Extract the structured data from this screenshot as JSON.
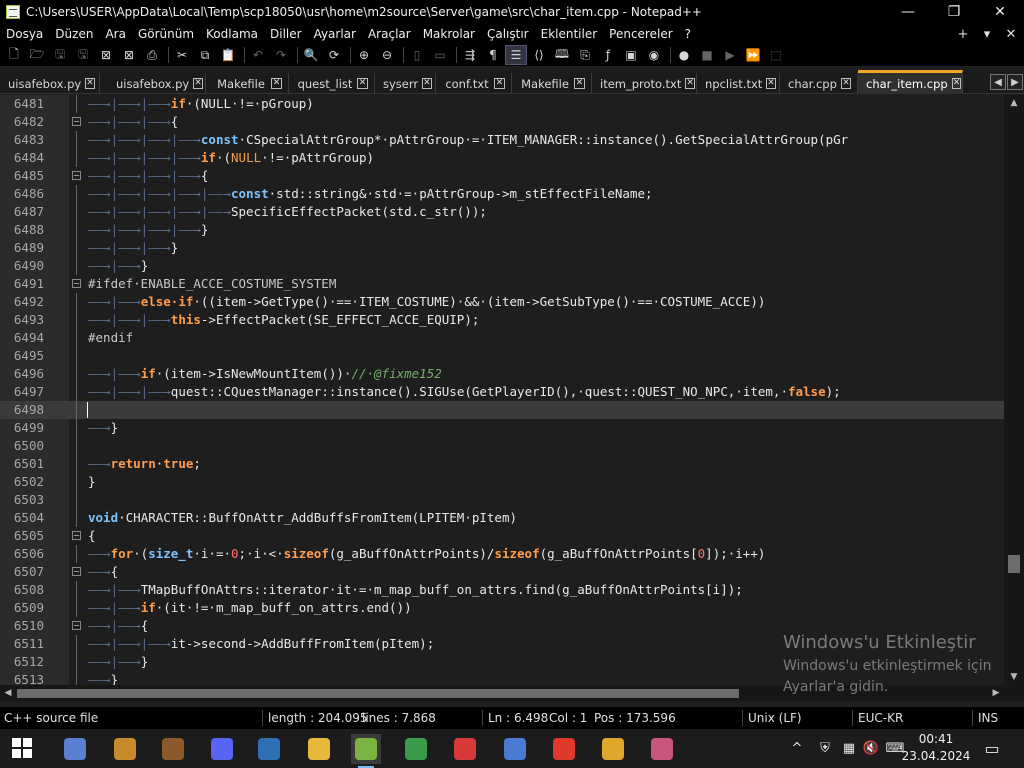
{
  "window": {
    "title": "C:\\Users\\USER\\AppData\\Local\\Temp\\scp18050\\usr\\home\\m2source\\Server\\game\\src\\char_item.cpp - Notepad++",
    "minimize": "—",
    "maximize": "❐",
    "close": "✕"
  },
  "menu": {
    "items": [
      "Dosya",
      "Düzen",
      "Ara",
      "Görünüm",
      "Kodlama",
      "Diller",
      "Ayarlar",
      "Araçlar",
      "Makrolar",
      "Çalıştır",
      "Eklentiler",
      "Pencereler",
      "?"
    ],
    "add": "+",
    "dropdown": "▾",
    "close": "✕"
  },
  "toolbar": {
    "icons": [
      "new-file-icon",
      "open-file-icon",
      "save-icon",
      "save-all-icon",
      "close-icon",
      "close-all-icon",
      "print-icon",
      "cut-icon",
      "copy-icon",
      "paste-icon",
      "undo-icon",
      "redo-icon",
      "find-icon",
      "replace-icon",
      "zoom-in-icon",
      "zoom-out-icon",
      "sync-vertical-icon",
      "sync-horizontal-icon",
      "word-wrap-icon",
      "show-all-chars-icon",
      "indent-guide-icon",
      "xml-icon",
      "book-icon",
      "clipboard-icon",
      "function-list-icon",
      "monitor-icon",
      "panel-icon",
      "record-macro-icon",
      "stop-record-icon",
      "play-macro-icon",
      "play-multiple-icon",
      "save-macro-icon"
    ]
  },
  "tabs": [
    {
      "label": "uisafebox.py"
    },
    {
      "label": "uisafebox.py"
    },
    {
      "label": "Makefile"
    },
    {
      "label": "quest_list"
    },
    {
      "label": "syserr"
    },
    {
      "label": "conf.txt"
    },
    {
      "label": "Makefile"
    },
    {
      "label": "item_proto.txt"
    },
    {
      "label": "npclist.txt"
    },
    {
      "label": "char.cpp"
    },
    {
      "label": "char_item.cpp"
    }
  ],
  "tab_close_glyph": "✕",
  "tab_nav": {
    "prev": "◀",
    "next": "▶"
  },
  "editor": {
    "lines": [
      {
        "n": "6481",
        "tokens": [
          [
            "ws",
            "——→|——→|——→"
          ],
          [
            "kw",
            "if"
          ],
          [
            "op",
            "·(NULL·!=·"
          ],
          [
            "id",
            "pGroup"
          ],
          [
            "op",
            ")"
          ]
        ]
      },
      {
        "n": "6482",
        "tokens": [
          [
            "ws",
            "——→|——→|——→"
          ],
          [
            "op",
            "{"
          ]
        ]
      },
      {
        "n": "6483",
        "tokens": [
          [
            "ws",
            "——→|——→|——→|——→"
          ],
          [
            "type",
            "const"
          ],
          [
            "op",
            "·"
          ],
          [
            "id",
            "CSpecialAttrGroup"
          ],
          [
            "op",
            "*·"
          ],
          [
            "id",
            "pAttrGroup"
          ],
          [
            "op",
            "·=·"
          ],
          [
            "id",
            "ITEM_MANAGER"
          ],
          [
            "op",
            "::"
          ],
          [
            "id",
            "instance"
          ],
          [
            "op",
            "()."
          ],
          [
            "id",
            "GetSpecialAttrGroup"
          ],
          [
            "op",
            "(pGr"
          ]
        ]
      },
      {
        "n": "6484",
        "tokens": [
          [
            "ws",
            "——→|——→|——→|——→"
          ],
          [
            "kw",
            "if"
          ],
          [
            "op",
            "·("
          ],
          [
            "const",
            "NULL"
          ],
          [
            "op",
            "·!=·"
          ],
          [
            "id",
            "pAttrGroup"
          ],
          [
            "op",
            ")"
          ]
        ]
      },
      {
        "n": "6485",
        "tokens": [
          [
            "ws",
            "——→|——→|——→|——→"
          ],
          [
            "op",
            "{"
          ]
        ]
      },
      {
        "n": "6486",
        "tokens": [
          [
            "ws",
            "——→|——→|——→|——→|——→"
          ],
          [
            "type",
            "const"
          ],
          [
            "op",
            "·"
          ],
          [
            "id",
            "std"
          ],
          [
            "op",
            "::"
          ],
          [
            "id",
            "string"
          ],
          [
            "op",
            "&·"
          ],
          [
            "id",
            "std"
          ],
          [
            "op",
            "·=·"
          ],
          [
            "id",
            "pAttrGroup"
          ],
          [
            "op",
            "->"
          ],
          [
            "id",
            "m_stEffectFileName"
          ],
          [
            "op",
            ";"
          ]
        ]
      },
      {
        "n": "6487",
        "tokens": [
          [
            "ws",
            "——→|——→|——→|——→|——→"
          ],
          [
            "id",
            "SpecificEffectPacket"
          ],
          [
            "op",
            "(std.c_str());"
          ]
        ]
      },
      {
        "n": "6488",
        "tokens": [
          [
            "ws",
            "——→|——→|——→|——→"
          ],
          [
            "op",
            "}"
          ]
        ]
      },
      {
        "n": "6489",
        "tokens": [
          [
            "ws",
            "——→|——→|——→"
          ],
          [
            "op",
            "}"
          ]
        ]
      },
      {
        "n": "6490",
        "tokens": [
          [
            "ws",
            "——→|——→"
          ],
          [
            "op",
            "}"
          ]
        ]
      },
      {
        "n": "6491",
        "tokens": [
          [
            "pp",
            "#ifdef·ENABLE_ACCE_COSTUME_SYSTEM"
          ]
        ]
      },
      {
        "n": "6492",
        "tokens": [
          [
            "ws",
            "——→|——→"
          ],
          [
            "kw",
            "else·if"
          ],
          [
            "op",
            "·((item->"
          ],
          [
            "id",
            "GetType"
          ],
          [
            "op",
            "()·==·"
          ],
          [
            "id",
            "ITEM_COSTUME"
          ],
          [
            "op",
            ")·&&·(item->"
          ],
          [
            "id",
            "GetSubType"
          ],
          [
            "op",
            "()·==·"
          ],
          [
            "id",
            "COSTUME_ACCE"
          ],
          [
            "op",
            "))"
          ]
        ]
      },
      {
        "n": "6493",
        "tokens": [
          [
            "ws",
            "——→|——→|——→"
          ],
          [
            "kw",
            "this"
          ],
          [
            "op",
            "->"
          ],
          [
            "id",
            "EffectPacket"
          ],
          [
            "op",
            "(SE_EFFECT_ACCE_EQUIP);"
          ]
        ]
      },
      {
        "n": "6494",
        "tokens": [
          [
            "pp",
            "#endif"
          ]
        ]
      },
      {
        "n": "6495",
        "tokens": []
      },
      {
        "n": "6496",
        "tokens": [
          [
            "ws",
            "——→|——→"
          ],
          [
            "kw",
            "if"
          ],
          [
            "op",
            "·(item->"
          ],
          [
            "id",
            "IsNewMountItem"
          ],
          [
            "op",
            "())·"
          ],
          [
            "cm",
            "//·@fixme152"
          ]
        ]
      },
      {
        "n": "6497",
        "tokens": [
          [
            "ws",
            "——→|——→|——→"
          ],
          [
            "id",
            "quest"
          ],
          [
            "op",
            "::"
          ],
          [
            "id",
            "CQuestManager"
          ],
          [
            "op",
            "::"
          ],
          [
            "id",
            "instance"
          ],
          [
            "op",
            "()."
          ],
          [
            "id",
            "SIGUse"
          ],
          [
            "op",
            "("
          ],
          [
            "id",
            "GetPlayerID"
          ],
          [
            "op",
            "(),·quest::QUEST_NO_NPC,·item,·"
          ],
          [
            "kw",
            "false"
          ],
          [
            "op",
            ");"
          ]
        ]
      },
      {
        "n": "6498",
        "tokens": [],
        "current": true
      },
      {
        "n": "6499",
        "tokens": [
          [
            "ws",
            "——→"
          ],
          [
            "op",
            "}"
          ]
        ]
      },
      {
        "n": "6500",
        "tokens": []
      },
      {
        "n": "6501",
        "tokens": [
          [
            "ws",
            "——→"
          ],
          [
            "kw",
            "return"
          ],
          [
            "op",
            "·"
          ],
          [
            "kw",
            "true"
          ],
          [
            "op",
            ";"
          ]
        ]
      },
      {
        "n": "6502",
        "tokens": [
          [
            "op",
            "}"
          ]
        ]
      },
      {
        "n": "6503",
        "tokens": []
      },
      {
        "n": "6504",
        "tokens": [
          [
            "type",
            "void"
          ],
          [
            "op",
            "·"
          ],
          [
            "id",
            "CHARACTER"
          ],
          [
            "op",
            "::"
          ],
          [
            "id",
            "BuffOnAttr_AddBuffsFromItem"
          ],
          [
            "op",
            "(LPITEM·pItem)"
          ]
        ]
      },
      {
        "n": "6505",
        "tokens": [
          [
            "op",
            "{"
          ]
        ]
      },
      {
        "n": "6506",
        "tokens": [
          [
            "ws",
            "——→"
          ],
          [
            "kw",
            "for"
          ],
          [
            "op",
            "·("
          ],
          [
            "type",
            "size_t"
          ],
          [
            "op",
            "·i·=·"
          ],
          [
            "num",
            "0"
          ],
          [
            "op",
            ";·i·<·"
          ],
          [
            "kw",
            "sizeof"
          ],
          [
            "op",
            "(g_aBuffOnAttrPoints)/"
          ],
          [
            "kw",
            "sizeof"
          ],
          [
            "op",
            "(g_aBuffOnAttrPoints["
          ],
          [
            "num",
            "0"
          ],
          [
            "op",
            "]);·i++)"
          ]
        ]
      },
      {
        "n": "6507",
        "tokens": [
          [
            "ws",
            "——→"
          ],
          [
            "op",
            "{"
          ]
        ]
      },
      {
        "n": "6508",
        "tokens": [
          [
            "ws",
            "——→|——→"
          ],
          [
            "id",
            "TMapBuffOnAttrs"
          ],
          [
            "op",
            "::"
          ],
          [
            "id",
            "iterator"
          ],
          [
            "op",
            "·it·=·m_map_buff_on_attrs."
          ],
          [
            "id",
            "find"
          ],
          [
            "op",
            "(g_aBuffOnAttrPoints[i]);"
          ]
        ]
      },
      {
        "n": "6509",
        "tokens": [
          [
            "ws",
            "——→|——→"
          ],
          [
            "kw",
            "if"
          ],
          [
            "op",
            "·(it·!=·m_map_buff_on_attrs."
          ],
          [
            "id",
            "end"
          ],
          [
            "op",
            "())"
          ]
        ]
      },
      {
        "n": "6510",
        "tokens": [
          [
            "ws",
            "——→|——→"
          ],
          [
            "op",
            "{"
          ]
        ]
      },
      {
        "n": "6511",
        "tokens": [
          [
            "ws",
            "——→|——→|——→"
          ],
          [
            "id",
            "it"
          ],
          [
            "op",
            "->"
          ],
          [
            "id",
            "second"
          ],
          [
            "op",
            "->"
          ],
          [
            "id",
            "AddBuffFromItem"
          ],
          [
            "op",
            "(pItem);"
          ]
        ]
      },
      {
        "n": "6512",
        "tokens": [
          [
            "ws",
            "——→|——→"
          ],
          [
            "op",
            "}"
          ]
        ]
      },
      {
        "n": "6513",
        "tokens": [
          [
            "ws",
            "——→"
          ],
          [
            "op",
            "}"
          ]
        ]
      }
    ]
  },
  "statusbar": {
    "file_type": "C++ source file",
    "length": "length : 204.095",
    "lines": "lines : 7.868",
    "ln": "Ln : 6.498",
    "col": "Col : 1",
    "pos": "Pos : 173.596",
    "eol": "Unix (LF)",
    "encoding": "EUC-KR",
    "mode": "INS"
  },
  "watermark": {
    "title": "Windows'u Etkinleştir",
    "subtitle": "Windows'u etkinleştirmek için Ayarlar'a gidin."
  },
  "taskbar": {
    "time": "00:41",
    "date": "23.04.2024",
    "apps": [
      {
        "name": "start-icon",
        "color": "#3a8ee6"
      },
      {
        "name": "network-tool-icon",
        "color": "#5a7fd1"
      },
      {
        "name": "m2-game-icon",
        "color": "#c78a2a"
      },
      {
        "name": "h-game-icon",
        "color": "#8a5a2a"
      },
      {
        "name": "discord-icon",
        "color": "#5865f2"
      },
      {
        "name": "virtualbox-icon",
        "color": "#2f6fb3"
      },
      {
        "name": "file-explorer-icon",
        "color": "#e8b83a"
      },
      {
        "name": "notepadpp-icon",
        "color": "#7bb342"
      },
      {
        "name": "transfer-tool-icon",
        "color": "#3a9a4a"
      },
      {
        "name": "red-tool-icon",
        "color": "#d83a3a"
      },
      {
        "name": "remote-desktop-icon",
        "color": "#4a7ad1"
      },
      {
        "name": "anydesk-icon",
        "color": "#e0392b"
      },
      {
        "name": "chrome-icon",
        "color": "#e0a82a"
      },
      {
        "name": "game-avatar-icon",
        "color": "#c9567a"
      }
    ],
    "tray": [
      "chevron-up-icon",
      "security-icon",
      "task-manager-icon",
      "speaker-muted-icon",
      "keyboard-icon"
    ],
    "chevron": "^",
    "notification": "▭"
  },
  "colors": {
    "tab_active_accent": "#f5a623",
    "keyword": "#ff9d4a",
    "type": "#7dc3ff",
    "comment": "#74b06a"
  }
}
